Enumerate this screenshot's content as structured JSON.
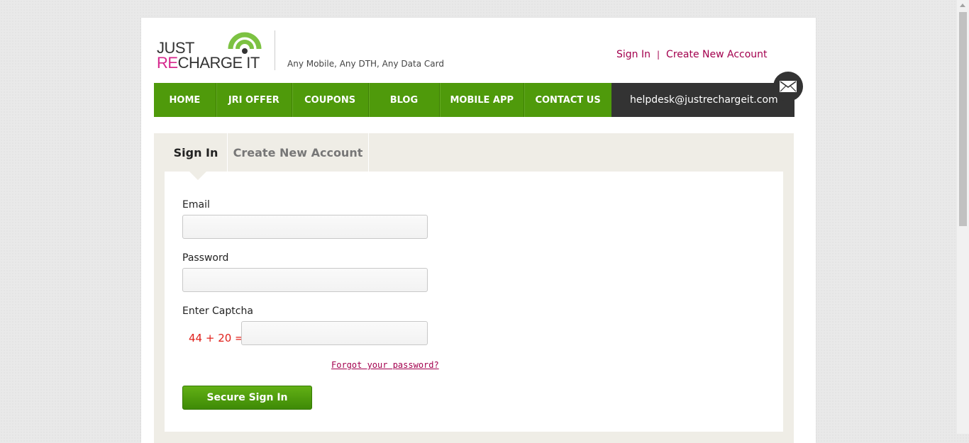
{
  "header": {
    "logo_just": "JUST",
    "logo_re": "RE",
    "logo_charge": "CHARGE IT",
    "tagline": "Any Mobile, Any DTH, Any Data Card",
    "signin_link": "Sign In",
    "separator": "|",
    "create_account_link": "Create New Account"
  },
  "nav": {
    "items": [
      {
        "label": "HOME"
      },
      {
        "label": "JRI OFFER"
      },
      {
        "label": "COUPONS"
      },
      {
        "label": "BLOG"
      },
      {
        "label": "MOBILE APP"
      },
      {
        "label": "CONTACT US"
      }
    ],
    "helpdesk_email": "helpdesk@justrechargeit.com"
  },
  "tabs": {
    "signin": "Sign In",
    "create": "Create New Account"
  },
  "form": {
    "email_label": "Email",
    "email_value": "",
    "password_label": "Password",
    "password_value": "",
    "captcha_label": "Enter Captcha",
    "captcha_question": "44 + 20 =",
    "captcha_value": "",
    "forgot_link": "Forgot your password?",
    "submit_label": "Secure Sign In"
  },
  "colors": {
    "brand_green": "#4f9a0b",
    "brand_pink": "#d6278c",
    "link_color": "#a3004e",
    "captcha_red": "#e0201b"
  }
}
